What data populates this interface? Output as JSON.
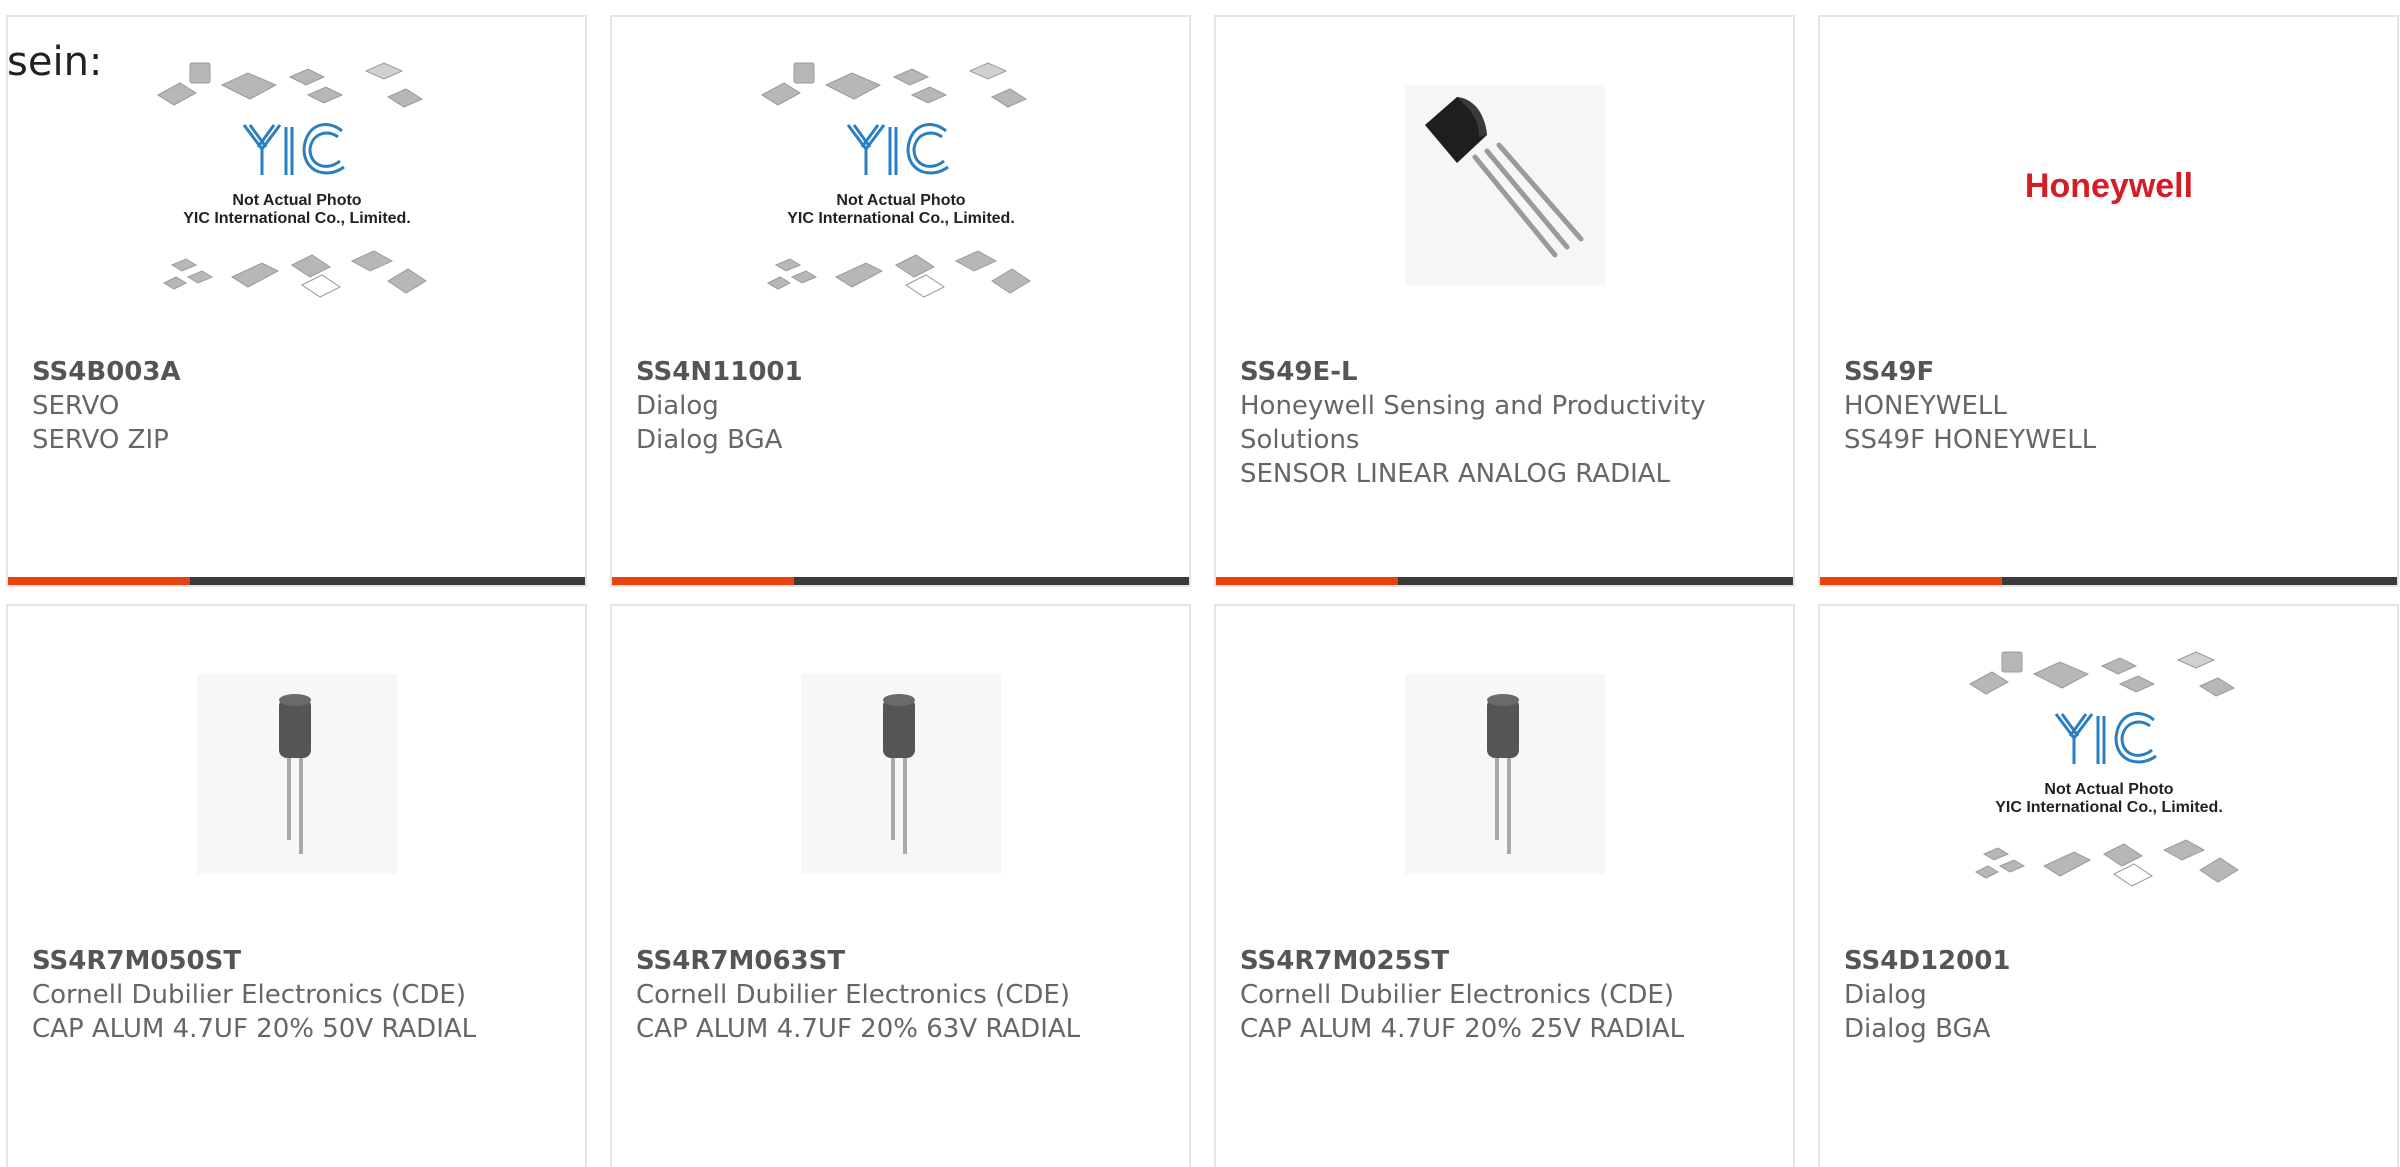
{
  "lead_text": "sein:",
  "placeholder": {
    "logo": "YIC",
    "line1": "Not Actual Photo",
    "line2": "YIC International Co., Limited."
  },
  "brand_logo_text": "Honeywell",
  "colors": {
    "accent": "#e8410e",
    "bar": "#3a3a3a",
    "border": "#e4e4e4",
    "logo_blue": "#2a7fc1",
    "honeywell_red": "#d21f26"
  },
  "products": [
    {
      "part": "SS4B003A",
      "manufacturer": "SERVO",
      "description": "SERVO ZIP",
      "image": "placeholder-photo"
    },
    {
      "part": "SS4N11001",
      "manufacturer": "Dialog",
      "description": "Dialog BGA",
      "image": "placeholder-photo"
    },
    {
      "part": "SS49E-L",
      "manufacturer": "Honeywell Sensing and Productivity Solutions",
      "description": "SENSOR LINEAR ANALOG RADIAL",
      "image": "to92-sensor-photo"
    },
    {
      "part": "SS49F",
      "manufacturer": "HONEYWELL",
      "description": "SS49F HONEYWELL",
      "image": "honeywell-logo"
    },
    {
      "part": "SS4R7M050ST",
      "manufacturer": "Cornell Dubilier Electronics (CDE)",
      "description": "CAP ALUM 4.7UF 20% 50V RADIAL",
      "image": "capacitor-photo"
    },
    {
      "part": "SS4R7M063ST",
      "manufacturer": "Cornell Dubilier Electronics (CDE)",
      "description": "CAP ALUM 4.7UF 20% 63V RADIAL",
      "image": "capacitor-photo"
    },
    {
      "part": "SS4R7M025ST",
      "manufacturer": "Cornell Dubilier Electronics (CDE)",
      "description": "CAP ALUM 4.7UF 20% 25V RADIAL",
      "image": "capacitor-photo"
    },
    {
      "part": "SS4D12001",
      "manufacturer": "Dialog",
      "description": "Dialog BGA",
      "image": "placeholder-photo"
    }
  ]
}
